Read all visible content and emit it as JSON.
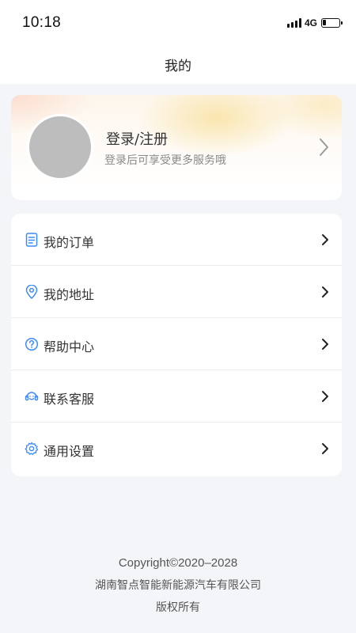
{
  "status_bar": {
    "time": "10:18",
    "network": "4G",
    "battery_level": 0.2
  },
  "nav": {
    "title": "我的"
  },
  "profile": {
    "title": "登录/注册",
    "subtitle": "登录后可享受更多服务哦",
    "arrow_icon": "chevron-right-icon"
  },
  "menu": {
    "accent_color": "#3d8cf5",
    "items": [
      {
        "label": "我的订单",
        "icon": "order-document-icon"
      },
      {
        "label": "我的地址",
        "icon": "location-pin-icon"
      },
      {
        "label": "帮助中心",
        "icon": "help-question-icon"
      },
      {
        "label": "联系客服",
        "icon": "customer-service-icon"
      },
      {
        "label": "通用设置",
        "icon": "gear-icon"
      }
    ]
  },
  "footer": {
    "copyright": "Copyright©2020–2028",
    "company": "湖南智点智能新能源汽车有限公司",
    "rights": "版权所有"
  }
}
